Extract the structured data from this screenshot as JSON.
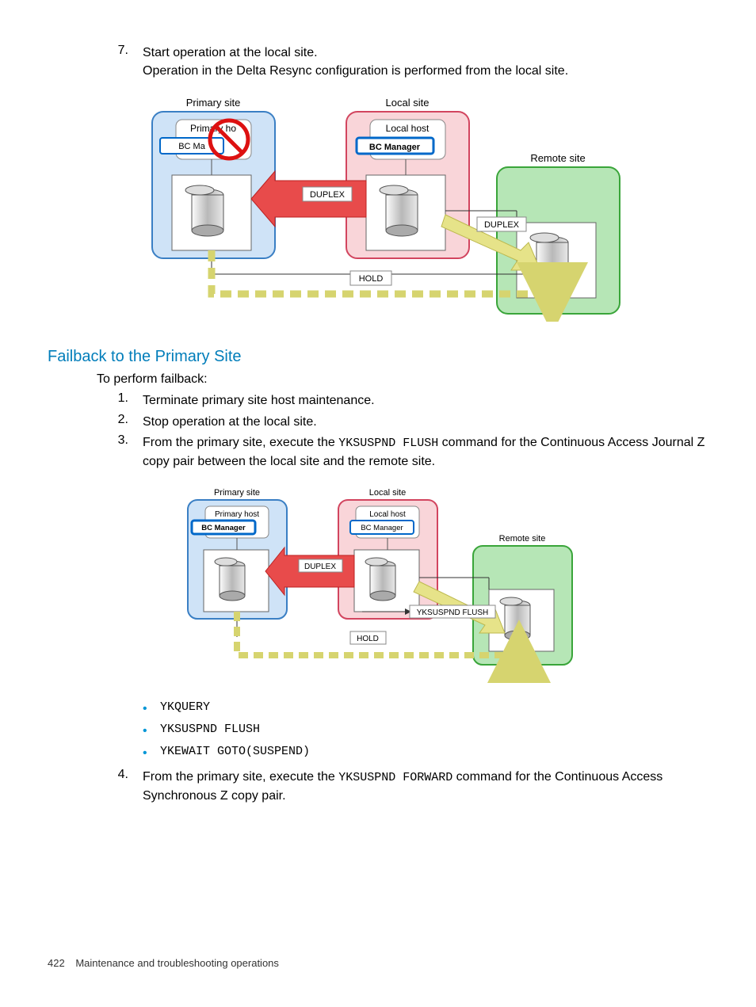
{
  "step7": {
    "num": "7.",
    "line1": "Start operation at the local site.",
    "line2": "Operation in the Delta Resync configuration is performed from the local site."
  },
  "diagram1": {
    "primary_site": "Primary site",
    "primary_host": "Primary ho",
    "bc_manager_p": "BC Ma",
    "local_site": "Local site",
    "local_host": "Local host",
    "bc_manager_l": "BC Manager",
    "remote_site": "Remote site",
    "duplex1": "DUPLEX",
    "duplex2": "DUPLEX",
    "hold": "HOLD"
  },
  "heading": "Failback to the Primary Site",
  "intro": "To perform failback:",
  "steps": [
    {
      "num": "1.",
      "text": "Terminate primary site host maintenance."
    },
    {
      "num": "2.",
      "text": "Stop operation at the local site."
    },
    {
      "num": "3.",
      "text_pre": "From the primary site, execute the ",
      "code": "YKSUSPND FLUSH",
      "text_post": " command for the Continuous Access Journal Z copy pair between the local site and the remote site."
    }
  ],
  "diagram2": {
    "primary_site": "Primary site",
    "primary_host": "Primary host",
    "bc_manager_p": "BC Manager",
    "local_site": "Local site",
    "local_host": "Local host",
    "bc_manager_l": "BC Manager",
    "remote_site": "Remote site",
    "duplex": "DUPLEX",
    "cmd": "YKSUSPND FLUSH",
    "hold": "HOLD"
  },
  "bullets": [
    "YKQUERY",
    "YKSUSPND FLUSH",
    "YKEWAIT GOTO(SUSPEND)"
  ],
  "step4": {
    "num": "4.",
    "text_pre": "From the primary site, execute the ",
    "code": "YKSUSPND FORWARD",
    "text_post": " command for the Continuous Access Synchronous Z copy pair."
  },
  "footer": {
    "page": "422",
    "title": "Maintenance and troubleshooting operations"
  }
}
